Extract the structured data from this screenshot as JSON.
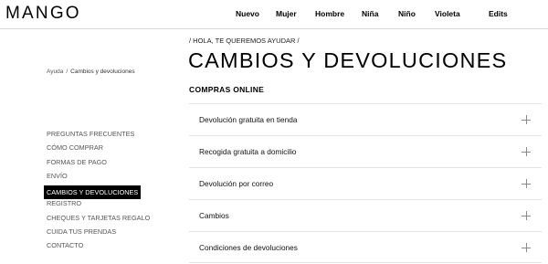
{
  "header": {
    "logo": "MANGO",
    "nav": [
      "Nuevo",
      "Mujer",
      "Hombre",
      "Niña",
      "Niño",
      "Violeta",
      "Edits"
    ]
  },
  "breadcrumb": {
    "root": "Ayuda",
    "separator": "/",
    "current": "Cambios y devoluciones"
  },
  "sidebar": {
    "items": [
      "PREGUNTAS FRECUENTES",
      "CÓMO COMPRAR",
      "FORMAS DE PAGO",
      "ENVÍO",
      "CAMBIOS Y DEVOLUCIONES",
      "REGISTRO",
      "CHEQUES Y TARJETAS REGALO",
      "CUIDA TUS PRENDAS",
      "CONTACTO"
    ],
    "active_index": 4
  },
  "main": {
    "help_crumb": "/ HOLA, TE QUEREMOS AYUDAR /",
    "title": "CAMBIOS Y DEVOLUCIONES",
    "section": "COMPRAS ONLINE",
    "faq": [
      "Devolución gratuita en tienda",
      "Recogida gratuita a domicilio",
      "Devolución por correo",
      "Cambios",
      "Condiciones de devoluciones"
    ]
  },
  "colors": {
    "text": "#000000",
    "muted": "#555555",
    "divider": "#e3e3e3",
    "active_bg": "#000000",
    "active_text": "#ffffff"
  }
}
